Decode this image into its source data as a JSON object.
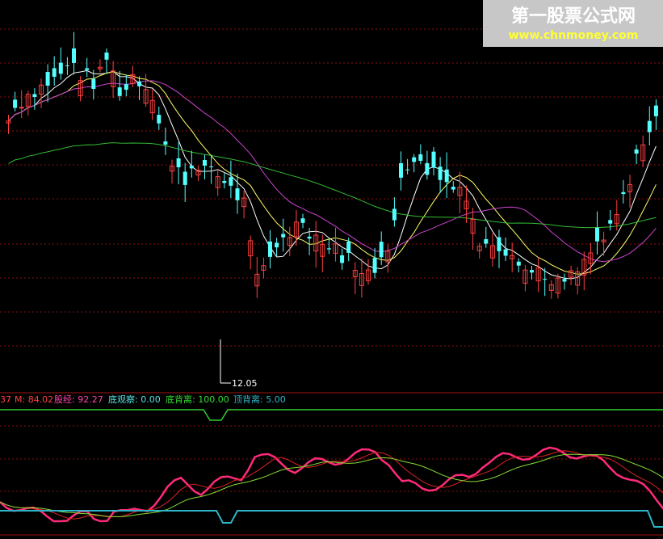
{
  "colors": {
    "background": "#000000",
    "grid": "#8a1010",
    "panel_border": "#a01414",
    "candle_up": "#ff4040",
    "candle_down": "#54ffff",
    "ma_short": "#ffffff",
    "ma_mid": "#ffff66",
    "ma_long1": "#cc44cc",
    "ma_long2": "#33bb33",
    "osc_main": "#ff2a7a",
    "osc_signal1": "#dd2222",
    "osc_signal2": "#88dd33",
    "osc_base": "#2fb5c8",
    "top_signal": "#33cc33"
  },
  "watermark": {
    "title": "第一股票公式网",
    "url": "www.chnmoney.com"
  },
  "price_panel": {
    "low_marker_label": "12.05"
  },
  "indicator_legend": [
    {
      "label": "37",
      "color": "#ff4040"
    },
    {
      "label": "M: 84.02",
      "color": "#ff4040"
    },
    {
      "label": "股经: 92.27",
      "color": "#ff44aa"
    },
    {
      "label": "底观察: 0.00",
      "color": "#55e0e0"
    },
    {
      "label": "底背离: 100.00",
      "color": "#33dd33"
    },
    {
      "label": "顶背离: 5.00",
      "color": "#2fb5c8"
    }
  ],
  "chart_data": [
    {
      "type": "candlestick",
      "title": "",
      "series": [
        {
          "name": "candles",
          "open": [],
          "close": []
        }
      ],
      "annotations": [
        "12.05"
      ],
      "grid": true
    },
    {
      "type": "line",
      "title": "",
      "series_names_from_legend": [
        "M",
        "股经",
        "底观察",
        "底背离",
        "顶背离"
      ],
      "values": {
        "M": 84.02,
        "股经": 92.27,
        "底观察": 0.0,
        "底背离": 100.0,
        "顶背离": 5.0
      }
    }
  ]
}
